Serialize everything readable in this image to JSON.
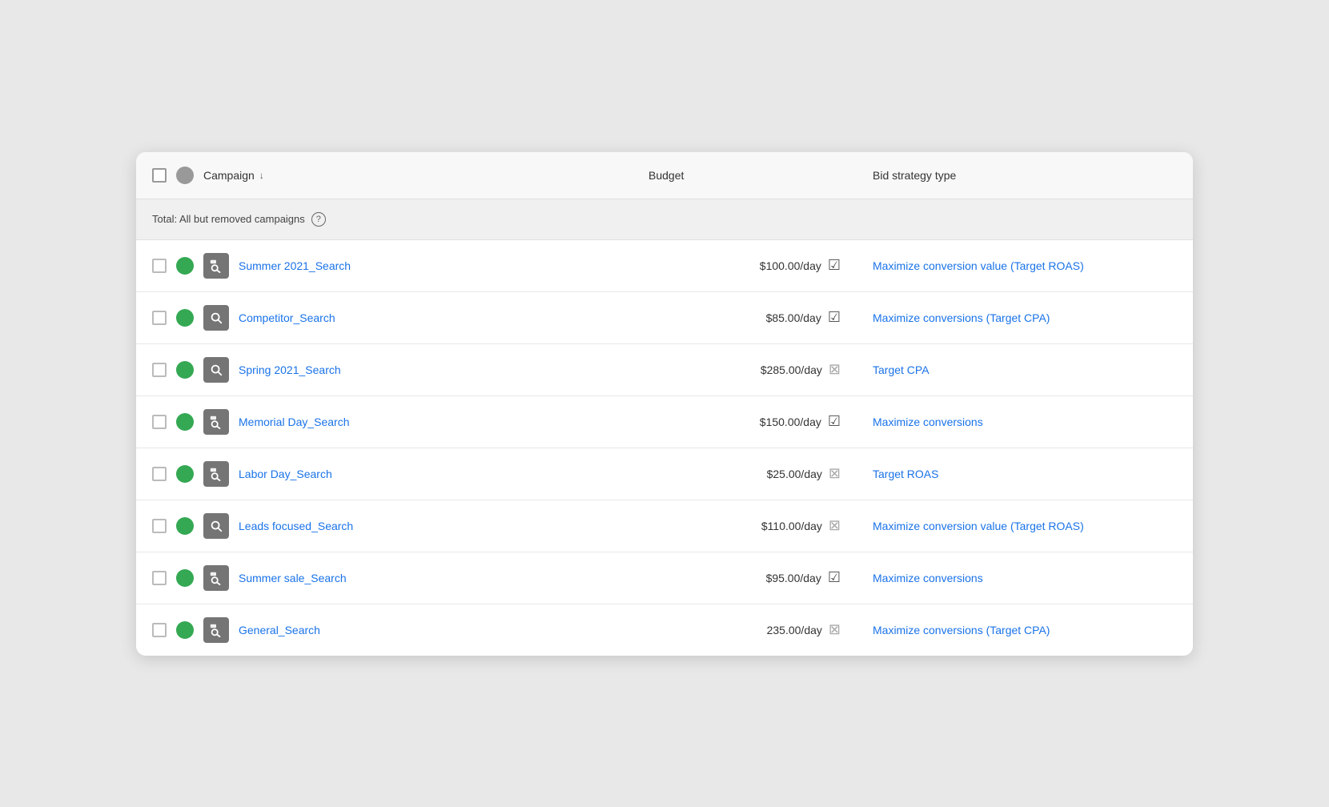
{
  "header": {
    "campaign_label": "Campaign",
    "budget_label": "Budget",
    "bid_strategy_label": "Bid strategy type"
  },
  "total_row": {
    "label": "Total: All but removed campaigns",
    "help_symbol": "?"
  },
  "campaigns": [
    {
      "id": 1,
      "name": "Summer 2021_Search",
      "budget": "$100.00/day",
      "budget_active": true,
      "bid_strategy": "Maximize conversion value (Target ROAS)",
      "icon_type": "search_ads"
    },
    {
      "id": 2,
      "name": "Competitor_Search",
      "budget": "$85.00/day",
      "budget_active": true,
      "bid_strategy": "Maximize conversions (Target CPA)",
      "icon_type": "search"
    },
    {
      "id": 3,
      "name": "Spring 2021_Search",
      "budget": "$285.00/day",
      "budget_active": false,
      "bid_strategy": "Target CPA",
      "icon_type": "search"
    },
    {
      "id": 4,
      "name": "Memorial Day_Search",
      "budget": "$150.00/day",
      "budget_active": true,
      "bid_strategy": "Maximize conversions",
      "icon_type": "search_ads"
    },
    {
      "id": 5,
      "name": "Labor Day_Search",
      "budget": "$25.00/day",
      "budget_active": false,
      "bid_strategy": "Target ROAS",
      "icon_type": "search_ads"
    },
    {
      "id": 6,
      "name": "Leads focused_Search",
      "budget": "$110.00/day",
      "budget_active": false,
      "bid_strategy": "Maximize conversion value (Target ROAS)",
      "icon_type": "search"
    },
    {
      "id": 7,
      "name": "Summer sale_Search",
      "budget": "$95.00/day",
      "budget_active": true,
      "bid_strategy": "Maximize conversions",
      "icon_type": "search_ads"
    },
    {
      "id": 8,
      "name": "General_Search",
      "budget": "235.00/day",
      "budget_active": false,
      "bid_strategy": "Maximize conversions (Target CPA)",
      "icon_type": "search_ads"
    }
  ]
}
